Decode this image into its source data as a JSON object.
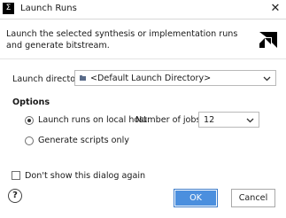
{
  "window": {
    "title": "Launch Runs",
    "app_icon": "Σ",
    "close_glyph": "✕"
  },
  "description": {
    "text": "Launch the selected synthesis or implementation runs and generate bitstream."
  },
  "launch_directory": {
    "label": "Launch directory:",
    "value": "<Default Launch Directory>",
    "icon": "folder-icon"
  },
  "options": {
    "title": "Options",
    "radio_local": {
      "label": "Launch runs on local host:",
      "selected": true
    },
    "radio_scripts": {
      "label": "Generate scripts only",
      "selected": false
    },
    "jobs_label": "Number of jobs:",
    "jobs_value": "12"
  },
  "footer": {
    "checkbox_label": "Don't show this dialog again",
    "checkbox_checked": false,
    "help_glyph": "?",
    "ok_label": "OK",
    "cancel_label": "Cancel"
  },
  "colors": {
    "ok_button": "#4b8fde",
    "ok_border": "#3d7cc9"
  }
}
